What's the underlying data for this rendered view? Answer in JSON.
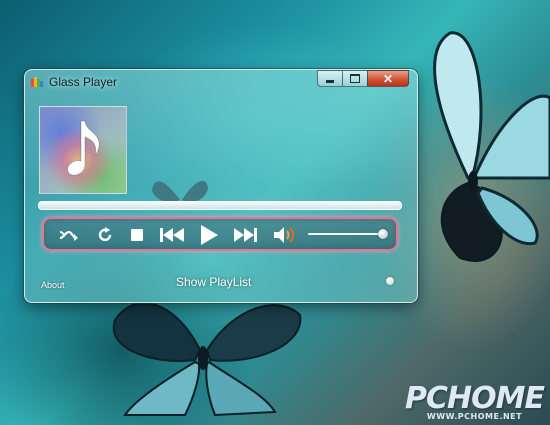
{
  "window": {
    "title": "Glass Player",
    "controls": {
      "minimize": "minimize-icon",
      "maximize": "maximize-icon",
      "close": "close-icon",
      "close_glyph": "✕"
    }
  },
  "album_art": {
    "icon": "music-note-icon"
  },
  "playback": {
    "progress": 1.0
  },
  "transport": {
    "buttons": [
      {
        "id": "shuffle",
        "icon": "shuffle-icon"
      },
      {
        "id": "repeat",
        "icon": "repeat-icon"
      },
      {
        "id": "stop",
        "icon": "stop-icon"
      },
      {
        "id": "previous",
        "icon": "previous-icon"
      },
      {
        "id": "play",
        "icon": "play-icon"
      },
      {
        "id": "next",
        "icon": "next-icon"
      },
      {
        "id": "mute",
        "icon": "volume-icon"
      }
    ],
    "volume": 1.0
  },
  "footer": {
    "about_label": "About",
    "playlist_label": "Show PlayList"
  },
  "colors": {
    "accent_ring": "#e57590",
    "close_button": "#d45a3d"
  },
  "watermark": {
    "logo": "PCHOME",
    "url": "WWW.PCHOME.NET"
  }
}
